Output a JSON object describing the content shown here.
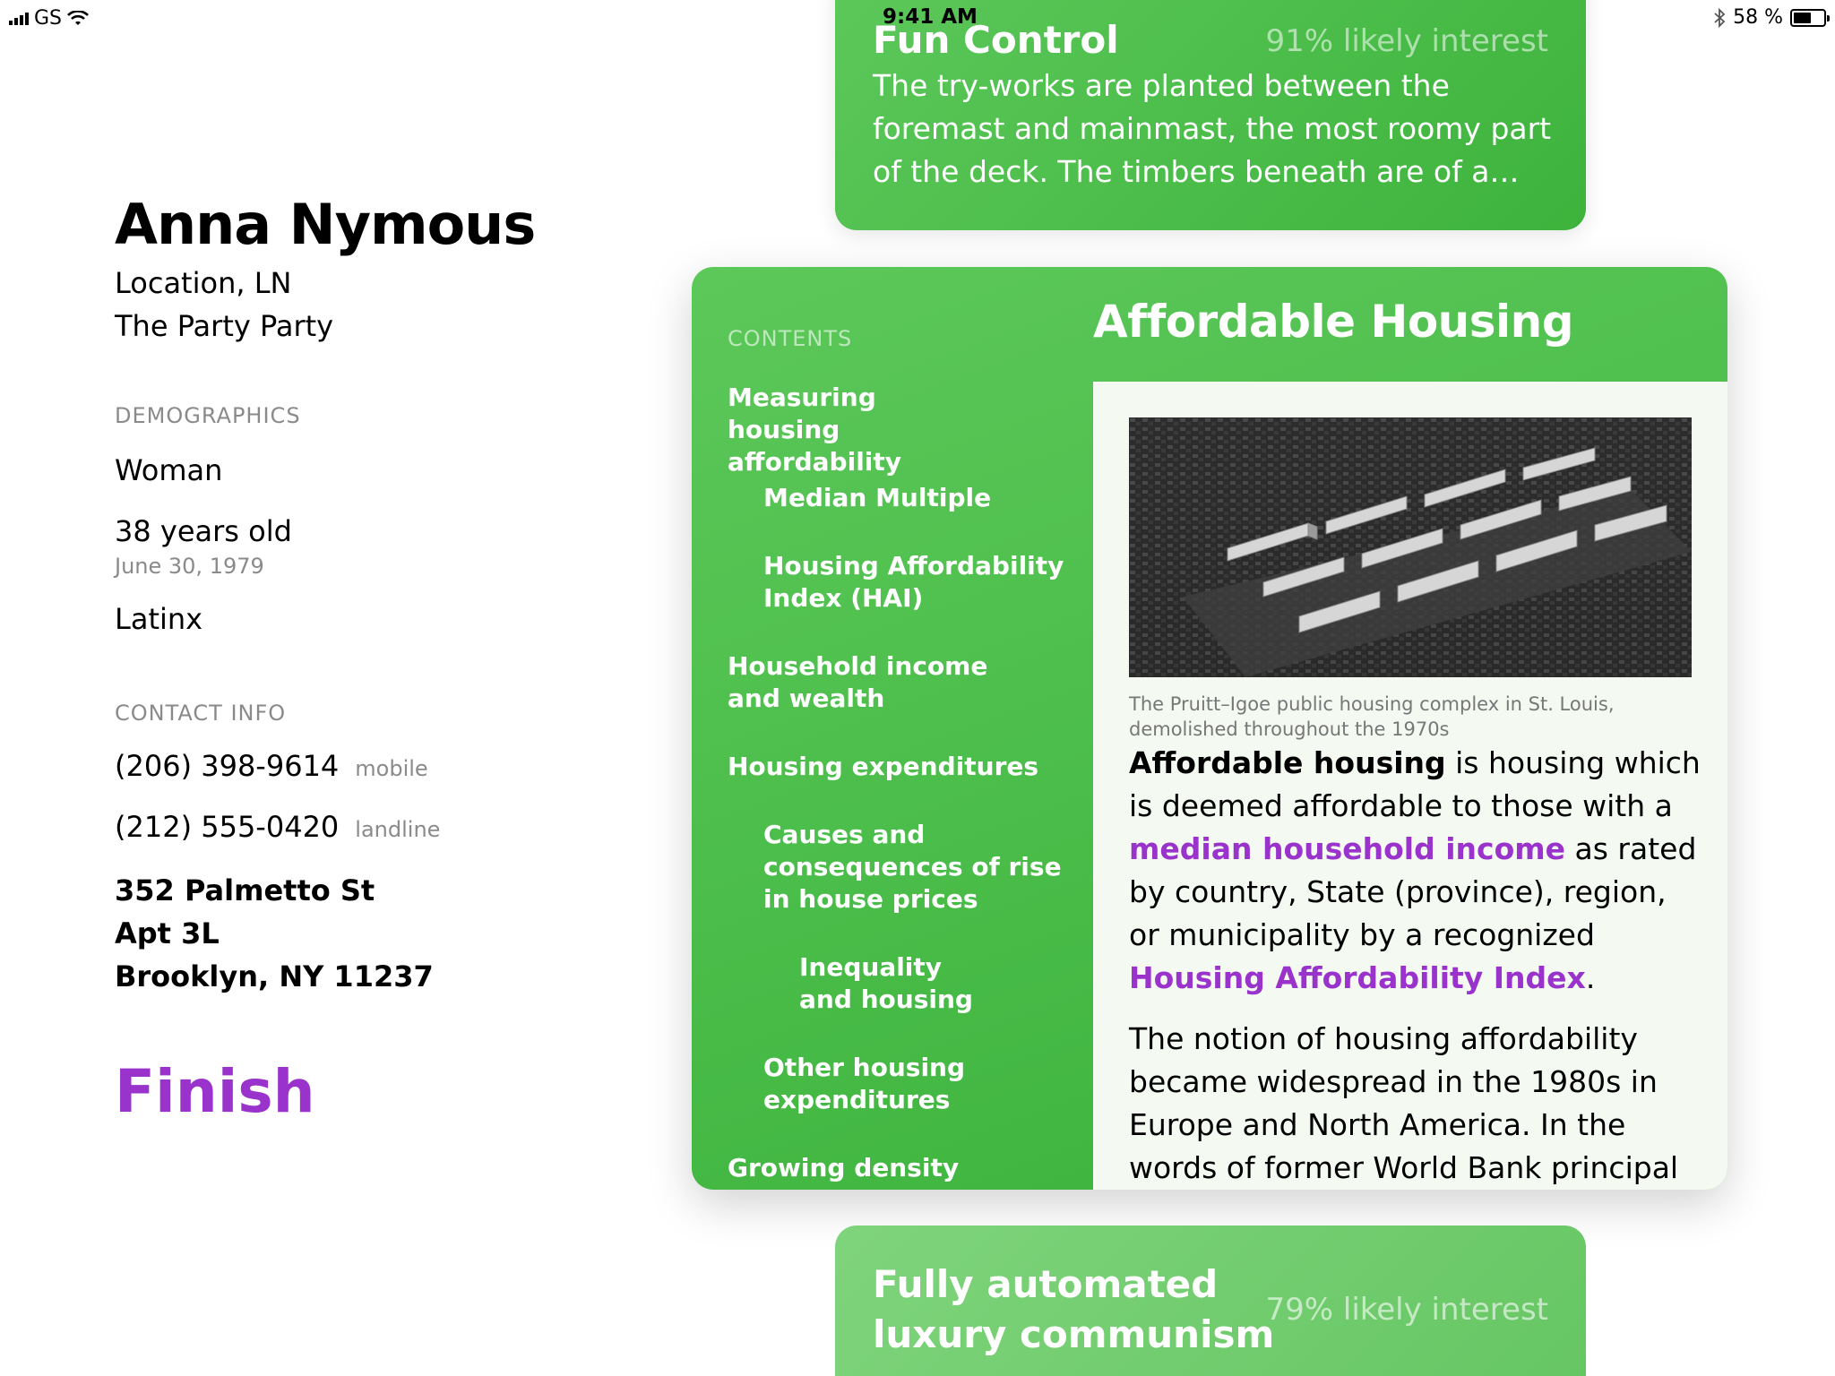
{
  "status_bar": {
    "carrier": "GS",
    "time": "9:41 AM",
    "battery_percent": "58 %",
    "battery_level": 0.58
  },
  "profile": {
    "name": "Anna Nymous",
    "location": "Location, LN",
    "party": "The Party Party",
    "demographics_label": "DEMOGRAPHICS",
    "gender": "Woman",
    "age": "38 years old",
    "birthdate": "June 30, 1979",
    "ethnicity": "Latinx",
    "contact_label": "CONTACT INFO",
    "phones": [
      {
        "number": "(206) 398-9614",
        "type": "mobile"
      },
      {
        "number": "(212) 555-0420",
        "type": "landline"
      }
    ],
    "address": {
      "line1": "352 Palmetto St",
      "line2": "Apt 3L",
      "line3": "Brooklyn, NY 11237"
    },
    "finish_label": "Finish"
  },
  "top_card": {
    "title": "Fun Control",
    "interest": "91% likely interest",
    "description": "The try-works are planted between the foremast and mainmast, the most roomy part of the deck. The timbers beneath are of a…"
  },
  "main_card": {
    "title": "Affordable Housing",
    "contents_label": "CONTENTS",
    "toc": [
      "Measuring housing affordability",
      "Median Multiple",
      "Housing Affordability Index (HAI)",
      "Household income and wealth",
      "Housing expenditures",
      "Causes and consequences of rise in house prices",
      "Inequality and housing",
      "Other housing expenditures",
      "Growing density"
    ],
    "caption": "The Pruitt–Igoe public housing complex in St. Louis, demolished throughout the 1970s",
    "para1": {
      "bold": "Affordable housing",
      "t1": " is housing which is deemed affordable to those with a ",
      "link1": "median household income",
      "t2": " as rated by country, State (province), region, or municipality by a recognized ",
      "link2": "Housing Affordability Index",
      "t3": "."
    },
    "para2": "The notion of housing affordability became widespread in the 1980s in Europe and North America. In the words of former World Bank principal"
  },
  "bottom_card": {
    "title": "Fully automated luxury communism",
    "interest": "79% likely interest"
  }
}
